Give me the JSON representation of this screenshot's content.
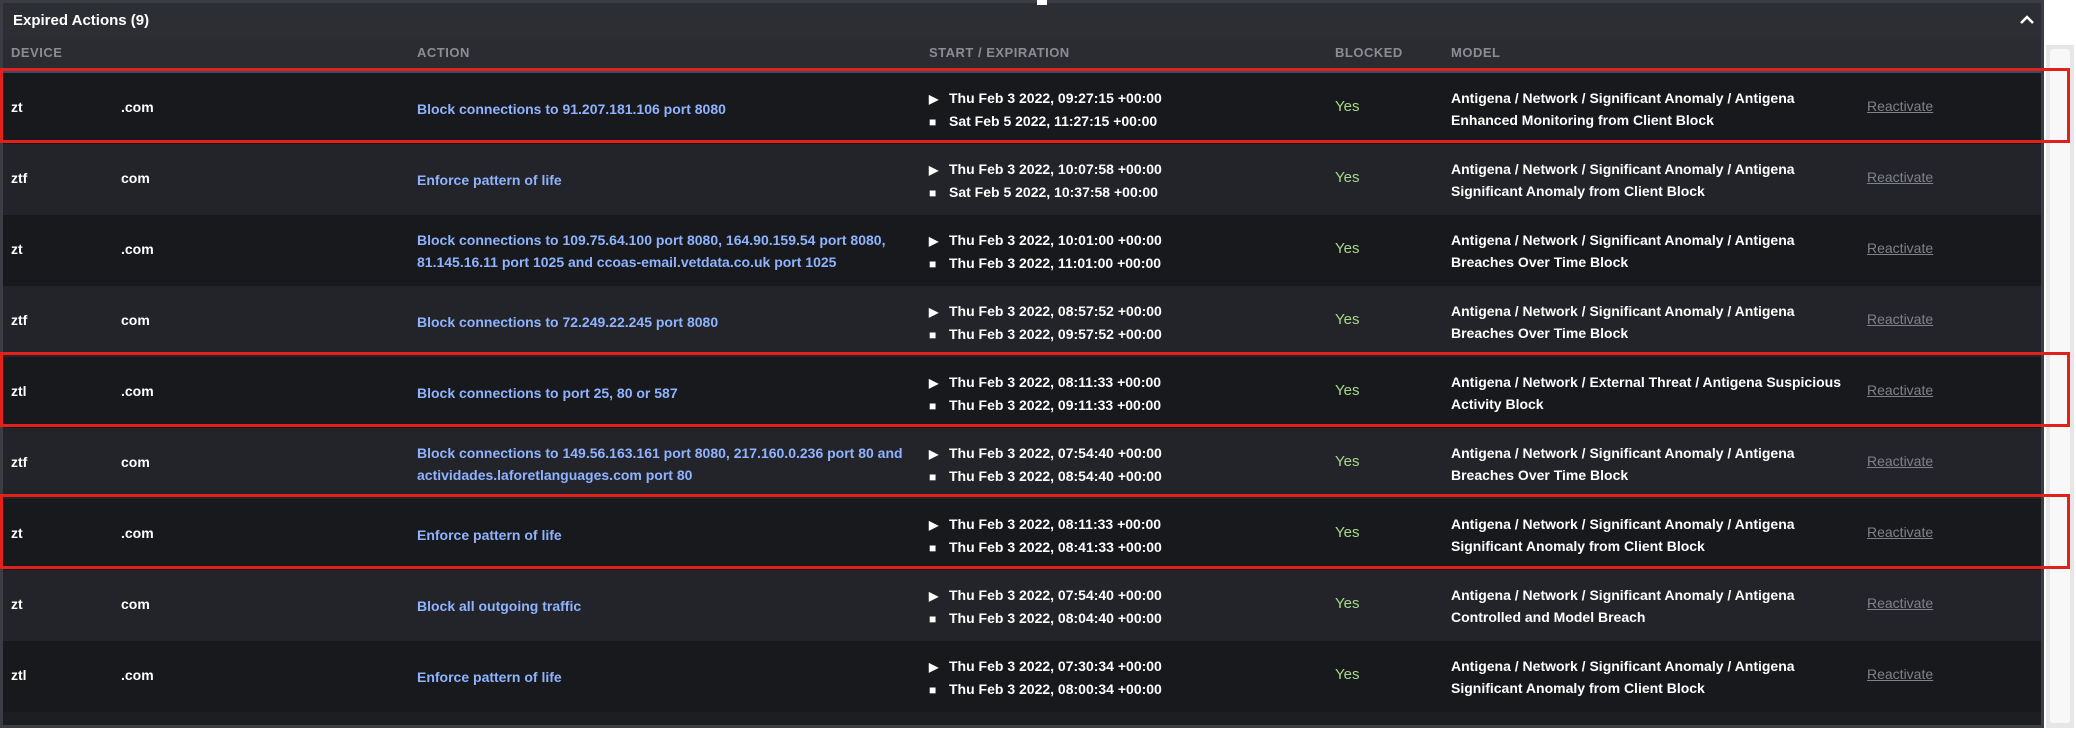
{
  "panel": {
    "title": "Expired Actions (9)"
  },
  "columns": {
    "device": "DEVICE",
    "action": "ACTION",
    "time": "START / EXPIRATION",
    "blocked": "BLOCKED",
    "model": "MODEL"
  },
  "colors": {
    "action": "#8fb3ff",
    "blocked": "#a7d98a",
    "highlight": "#e3211a"
  },
  "rows": [
    {
      "device_prefix": "zt",
      "device_suffix": ".com",
      "action": "Block connections to 91.207.181.106 port 8080",
      "start": "Thu Feb 3 2022, 09:27:15 +00:00",
      "expiration": "Sat Feb 5 2022, 11:27:15 +00:00",
      "blocked": "Yes",
      "model": "Antigena / Network / Significant Anomaly / Antigena Enhanced Monitoring from Client Block",
      "reactivate": "Reactivate"
    },
    {
      "device_prefix": "ztf",
      "device_suffix": "com",
      "action": "Enforce pattern of life",
      "start": "Thu Feb 3 2022, 10:07:58 +00:00",
      "expiration": "Sat Feb 5 2022, 10:37:58 +00:00",
      "blocked": "Yes",
      "model": "Antigena / Network / Significant Anomaly / Antigena Significant Anomaly from Client Block",
      "reactivate": "Reactivate"
    },
    {
      "device_prefix": "zt",
      "device_suffix": ".com",
      "action": "Block connections to 109.75.64.100 port 8080, 164.90.159.54 port 8080, 81.145.16.11 port 1025 and ccoas-email.vetdata.co.uk port 1025",
      "start": "Thu Feb 3 2022, 10:01:00 +00:00",
      "expiration": "Thu Feb 3 2022, 11:01:00 +00:00",
      "blocked": "Yes",
      "model": "Antigena / Network / Significant Anomaly / Antigena Breaches Over Time Block",
      "reactivate": "Reactivate"
    },
    {
      "device_prefix": "ztf",
      "device_suffix": "com",
      "action": "Block connections to 72.249.22.245 port 8080",
      "start": "Thu Feb 3 2022, 08:57:52 +00:00",
      "expiration": "Thu Feb 3 2022, 09:57:52 +00:00",
      "blocked": "Yes",
      "model": "Antigena / Network / Significant Anomaly / Antigena Breaches Over Time Block",
      "reactivate": "Reactivate"
    },
    {
      "device_prefix": "ztl",
      "device_suffix": ".com",
      "action": "Block connections to port 25, 80 or 587",
      "start": "Thu Feb 3 2022, 08:11:33 +00:00",
      "expiration": "Thu Feb 3 2022, 09:11:33 +00:00",
      "blocked": "Yes",
      "model": "Antigena / Network / External Threat / Antigena Suspicious Activity Block",
      "reactivate": "Reactivate"
    },
    {
      "device_prefix": "ztf",
      "device_suffix": "com",
      "action": "Block connections to 149.56.163.161 port 8080, 217.160.0.236 port 80 and actividades.laforetlanguages.com port 80",
      "start": "Thu Feb 3 2022, 07:54:40 +00:00",
      "expiration": "Thu Feb 3 2022, 08:54:40 +00:00",
      "blocked": "Yes",
      "model": "Antigena / Network / Significant Anomaly / Antigena Breaches Over Time Block",
      "reactivate": "Reactivate"
    },
    {
      "device_prefix": "zt",
      "device_suffix": ".com",
      "action": "Enforce pattern of life",
      "start": "Thu Feb 3 2022, 08:11:33 +00:00",
      "expiration": "Thu Feb 3 2022, 08:41:33 +00:00",
      "blocked": "Yes",
      "model": "Antigena / Network / Significant Anomaly / Antigena Significant Anomaly from Client Block",
      "reactivate": "Reactivate"
    },
    {
      "device_prefix": "zt",
      "device_suffix": "com",
      "action": "Block all outgoing traffic",
      "start": "Thu Feb 3 2022, 07:54:40 +00:00",
      "expiration": "Thu Feb 3 2022, 08:04:40 +00:00",
      "blocked": "Yes",
      "model": "Antigena / Network / Significant Anomaly / Antigena Controlled and Model Breach",
      "reactivate": "Reactivate"
    },
    {
      "device_prefix": "ztl",
      "device_suffix": ".com",
      "action": "Enforce pattern of life",
      "start": "Thu Feb 3 2022, 07:30:34 +00:00",
      "expiration": "Thu Feb 3 2022, 08:00:34 +00:00",
      "blocked": "Yes",
      "model": "Antigena / Network / Significant Anomaly / Antigena Significant Anomaly from Client Block",
      "reactivate": "Reactivate"
    }
  ]
}
